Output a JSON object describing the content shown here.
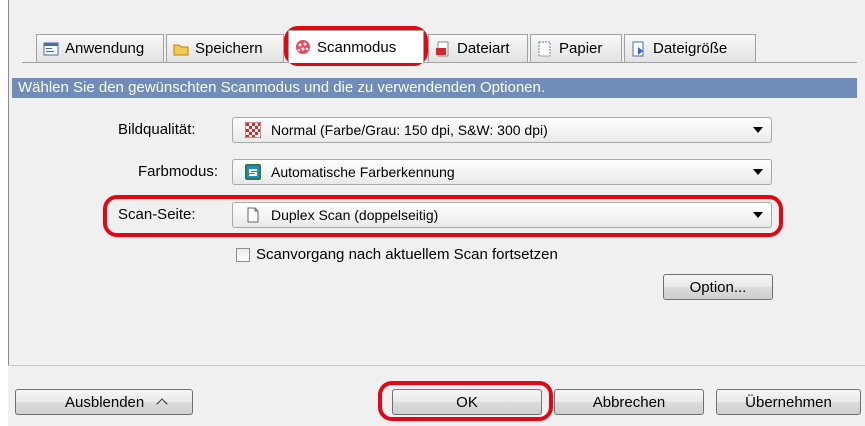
{
  "tabs": [
    {
      "label": "Anwendung",
      "icon": "application-icon"
    },
    {
      "label": "Speichern",
      "icon": "folder-icon"
    },
    {
      "label": "Scanmodus",
      "icon": "scanmode-icon"
    },
    {
      "label": "Dateiart",
      "icon": "pdf-file-icon"
    },
    {
      "label": "Papier",
      "icon": "paper-icon"
    },
    {
      "label": "Dateigröße",
      "icon": "filesize-icon"
    }
  ],
  "header": "Wählen Sie den gewünschten Scanmodus und die zu verwendenden Optionen.",
  "fields": {
    "bildqualitaet": {
      "label": "Bildqualität:",
      "value": "Normal (Farbe/Grau: 150 dpi, S&W: 300 dpi)",
      "icon": "quality-icon"
    },
    "farbmodus": {
      "label": "Farbmodus:",
      "value": "Automatische Farberkennung",
      "icon": "color-mode-icon"
    },
    "scanseite": {
      "label": "Scan-Seite:",
      "value": "Duplex Scan (doppelseitig)",
      "icon": "page-icon"
    }
  },
  "checkbox": {
    "label": "Scanvorgang nach aktuellem Scan fortsetzen",
    "checked": false
  },
  "option_button": "Option...",
  "footer": {
    "hide": "Ausblenden",
    "ok": "OK",
    "cancel": "Abbrechen",
    "apply": "Übernehmen"
  },
  "colors": {
    "header_bar": "#6f8db8",
    "highlight": "#e30613"
  }
}
